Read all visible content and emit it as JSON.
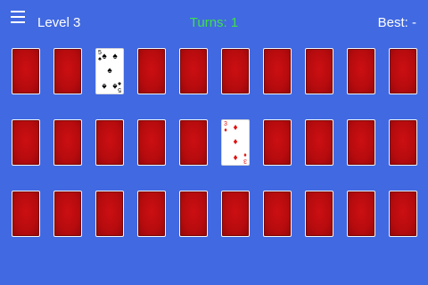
{
  "header": {
    "menu_icon": "hamburger-menu-icon",
    "level": "Level 3",
    "turns": "Turns: 1",
    "best": "Best: -"
  },
  "board": {
    "rows": 3,
    "cols": 10,
    "revealed": [
      {
        "row": 0,
        "col": 2,
        "rank": "5",
        "suit": "spade",
        "suit_symbol": "♠",
        "color": "black",
        "pips": 5
      },
      {
        "row": 1,
        "col": 5,
        "rank": "3",
        "suit": "diamond",
        "suit_symbol": "♦",
        "color": "red",
        "pips": 3
      }
    ]
  },
  "colors": {
    "background": "#4169e1",
    "card_back": "#b50b0e",
    "turns_text": "#3fe04a"
  }
}
